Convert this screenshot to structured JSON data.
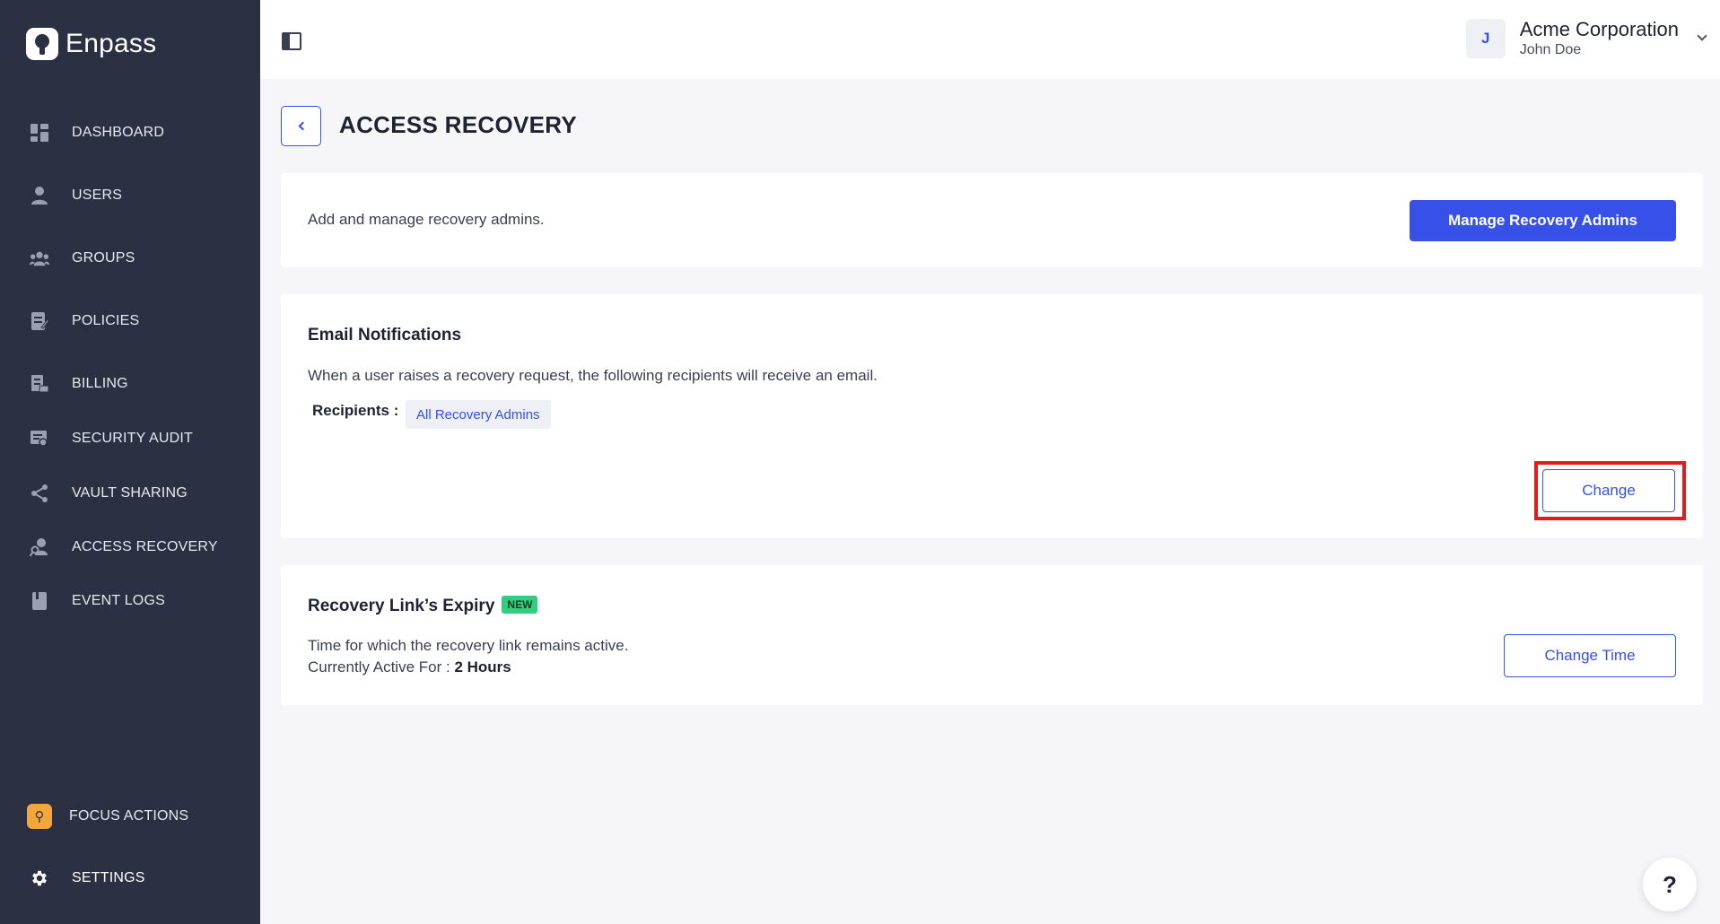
{
  "brand": {
    "name": "Enpass"
  },
  "sidebar": {
    "items": [
      {
        "label": "DASHBOARD",
        "icon": "dashboard-icon"
      },
      {
        "label": "USERS",
        "icon": "user-icon"
      },
      {
        "label": "GROUPS",
        "icon": "groups-icon"
      },
      {
        "label": "POLICIES",
        "icon": "policies-icon"
      },
      {
        "label": "BILLING",
        "icon": "billing-icon"
      },
      {
        "label": "SECURITY AUDIT",
        "icon": "security-audit-icon"
      },
      {
        "label": "VAULT SHARING",
        "icon": "share-icon"
      },
      {
        "label": "ACCESS RECOVERY",
        "icon": "access-recovery-icon"
      },
      {
        "label": "EVENT LOGS",
        "icon": "event-logs-icon"
      }
    ],
    "bottom": [
      {
        "label": "FOCUS ACTIONS",
        "icon": "focus-actions-icon"
      },
      {
        "label": "SETTINGS",
        "icon": "gear-icon"
      }
    ]
  },
  "header": {
    "avatar_initial": "J",
    "org_name": "Acme Corporation",
    "user_name": "John Doe"
  },
  "page": {
    "title": "ACCESS RECOVERY"
  },
  "admins_card": {
    "description": "Add and manage recovery admins.",
    "button": "Manage Recovery Admins"
  },
  "email_card": {
    "title": "Email Notifications",
    "description": "When a user raises a recovery request, the following recipients will receive an email.",
    "recipients_label": "Recipients :",
    "recipient": "All Recovery Admins",
    "button": "Change"
  },
  "expiry_card": {
    "title": "Recovery Link’s Expiry",
    "badge": "NEW",
    "description": "Time for which the recovery link remains active.",
    "active_label": "Currently Active For :",
    "active_value": "2 Hours",
    "button": "Change Time"
  },
  "help": {
    "label": "?"
  },
  "colors": {
    "sidebar": "#2b3142",
    "accent": "#3650e8",
    "highlight": "#e21b1b",
    "new_badge": "#2ecf7e"
  }
}
